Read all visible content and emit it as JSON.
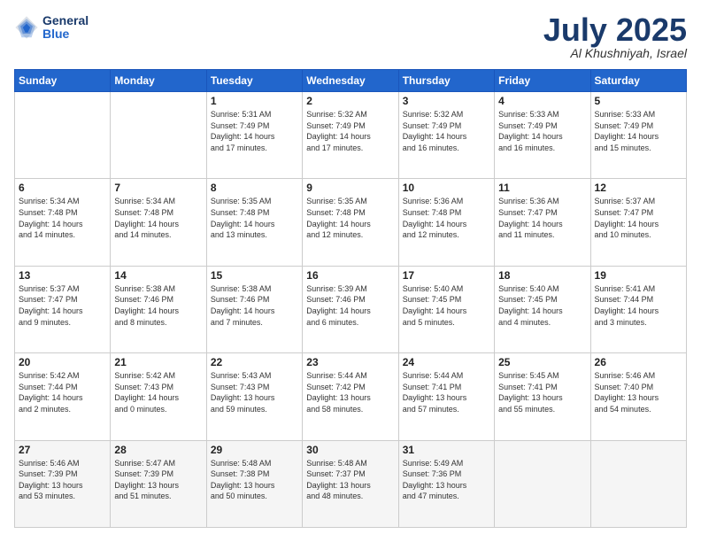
{
  "header": {
    "logo_general": "General",
    "logo_blue": "Blue",
    "month": "July 2025",
    "location": "Al Khushniyah, Israel"
  },
  "weekdays": [
    "Sunday",
    "Monday",
    "Tuesday",
    "Wednesday",
    "Thursday",
    "Friday",
    "Saturday"
  ],
  "weeks": [
    [
      {
        "day": "",
        "info": ""
      },
      {
        "day": "",
        "info": ""
      },
      {
        "day": "1",
        "info": "Sunrise: 5:31 AM\nSunset: 7:49 PM\nDaylight: 14 hours\nand 17 minutes."
      },
      {
        "day": "2",
        "info": "Sunrise: 5:32 AM\nSunset: 7:49 PM\nDaylight: 14 hours\nand 17 minutes."
      },
      {
        "day": "3",
        "info": "Sunrise: 5:32 AM\nSunset: 7:49 PM\nDaylight: 14 hours\nand 16 minutes."
      },
      {
        "day": "4",
        "info": "Sunrise: 5:33 AM\nSunset: 7:49 PM\nDaylight: 14 hours\nand 16 minutes."
      },
      {
        "day": "5",
        "info": "Sunrise: 5:33 AM\nSunset: 7:49 PM\nDaylight: 14 hours\nand 15 minutes."
      }
    ],
    [
      {
        "day": "6",
        "info": "Sunrise: 5:34 AM\nSunset: 7:48 PM\nDaylight: 14 hours\nand 14 minutes."
      },
      {
        "day": "7",
        "info": "Sunrise: 5:34 AM\nSunset: 7:48 PM\nDaylight: 14 hours\nand 14 minutes."
      },
      {
        "day": "8",
        "info": "Sunrise: 5:35 AM\nSunset: 7:48 PM\nDaylight: 14 hours\nand 13 minutes."
      },
      {
        "day": "9",
        "info": "Sunrise: 5:35 AM\nSunset: 7:48 PM\nDaylight: 14 hours\nand 12 minutes."
      },
      {
        "day": "10",
        "info": "Sunrise: 5:36 AM\nSunset: 7:48 PM\nDaylight: 14 hours\nand 12 minutes."
      },
      {
        "day": "11",
        "info": "Sunrise: 5:36 AM\nSunset: 7:47 PM\nDaylight: 14 hours\nand 11 minutes."
      },
      {
        "day": "12",
        "info": "Sunrise: 5:37 AM\nSunset: 7:47 PM\nDaylight: 14 hours\nand 10 minutes."
      }
    ],
    [
      {
        "day": "13",
        "info": "Sunrise: 5:37 AM\nSunset: 7:47 PM\nDaylight: 14 hours\nand 9 minutes."
      },
      {
        "day": "14",
        "info": "Sunrise: 5:38 AM\nSunset: 7:46 PM\nDaylight: 14 hours\nand 8 minutes."
      },
      {
        "day": "15",
        "info": "Sunrise: 5:38 AM\nSunset: 7:46 PM\nDaylight: 14 hours\nand 7 minutes."
      },
      {
        "day": "16",
        "info": "Sunrise: 5:39 AM\nSunset: 7:46 PM\nDaylight: 14 hours\nand 6 minutes."
      },
      {
        "day": "17",
        "info": "Sunrise: 5:40 AM\nSunset: 7:45 PM\nDaylight: 14 hours\nand 5 minutes."
      },
      {
        "day": "18",
        "info": "Sunrise: 5:40 AM\nSunset: 7:45 PM\nDaylight: 14 hours\nand 4 minutes."
      },
      {
        "day": "19",
        "info": "Sunrise: 5:41 AM\nSunset: 7:44 PM\nDaylight: 14 hours\nand 3 minutes."
      }
    ],
    [
      {
        "day": "20",
        "info": "Sunrise: 5:42 AM\nSunset: 7:44 PM\nDaylight: 14 hours\nand 2 minutes."
      },
      {
        "day": "21",
        "info": "Sunrise: 5:42 AM\nSunset: 7:43 PM\nDaylight: 14 hours\nand 0 minutes."
      },
      {
        "day": "22",
        "info": "Sunrise: 5:43 AM\nSunset: 7:43 PM\nDaylight: 13 hours\nand 59 minutes."
      },
      {
        "day": "23",
        "info": "Sunrise: 5:44 AM\nSunset: 7:42 PM\nDaylight: 13 hours\nand 58 minutes."
      },
      {
        "day": "24",
        "info": "Sunrise: 5:44 AM\nSunset: 7:41 PM\nDaylight: 13 hours\nand 57 minutes."
      },
      {
        "day": "25",
        "info": "Sunrise: 5:45 AM\nSunset: 7:41 PM\nDaylight: 13 hours\nand 55 minutes."
      },
      {
        "day": "26",
        "info": "Sunrise: 5:46 AM\nSunset: 7:40 PM\nDaylight: 13 hours\nand 54 minutes."
      }
    ],
    [
      {
        "day": "27",
        "info": "Sunrise: 5:46 AM\nSunset: 7:39 PM\nDaylight: 13 hours\nand 53 minutes."
      },
      {
        "day": "28",
        "info": "Sunrise: 5:47 AM\nSunset: 7:39 PM\nDaylight: 13 hours\nand 51 minutes."
      },
      {
        "day": "29",
        "info": "Sunrise: 5:48 AM\nSunset: 7:38 PM\nDaylight: 13 hours\nand 50 minutes."
      },
      {
        "day": "30",
        "info": "Sunrise: 5:48 AM\nSunset: 7:37 PM\nDaylight: 13 hours\nand 48 minutes."
      },
      {
        "day": "31",
        "info": "Sunrise: 5:49 AM\nSunset: 7:36 PM\nDaylight: 13 hours\nand 47 minutes."
      },
      {
        "day": "",
        "info": ""
      },
      {
        "day": "",
        "info": ""
      }
    ]
  ]
}
